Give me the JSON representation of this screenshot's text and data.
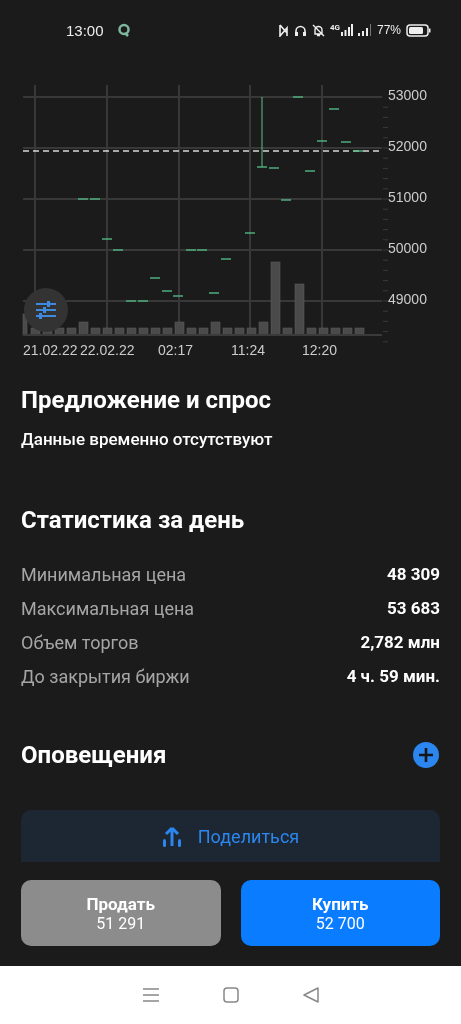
{
  "status_bar": {
    "time": "13:00",
    "network": "4G",
    "battery": "77%"
  },
  "chart": {
    "y_labels": [
      "53000",
      "52000",
      "51000",
      "50000",
      "49000"
    ],
    "x_labels": [
      "21.02.22",
      "22.02.22",
      "02:17",
      "11:24",
      "12:20"
    ]
  },
  "order_book": {
    "title": "Предложение и спрос",
    "message": "Данные временно отсутствуют"
  },
  "day_stats": {
    "title": "Статистика за день",
    "rows": [
      {
        "label": "Минимальная цена",
        "value": "48 309"
      },
      {
        "label": "Максимальная цена",
        "value": "53 683"
      },
      {
        "label": "Объем торгов",
        "value": "2,782 млн"
      },
      {
        "label": "До закрытия биржи",
        "value": "4 ч. 59 мин."
      }
    ]
  },
  "alerts": {
    "title": "Оповещения"
  },
  "share_button": "Поделиться",
  "actions": [
    {
      "kind": "sell",
      "label": "Продать",
      "price": "51 291"
    },
    {
      "kind": "buy",
      "label": "Купить",
      "price": "52 700"
    }
  ]
}
